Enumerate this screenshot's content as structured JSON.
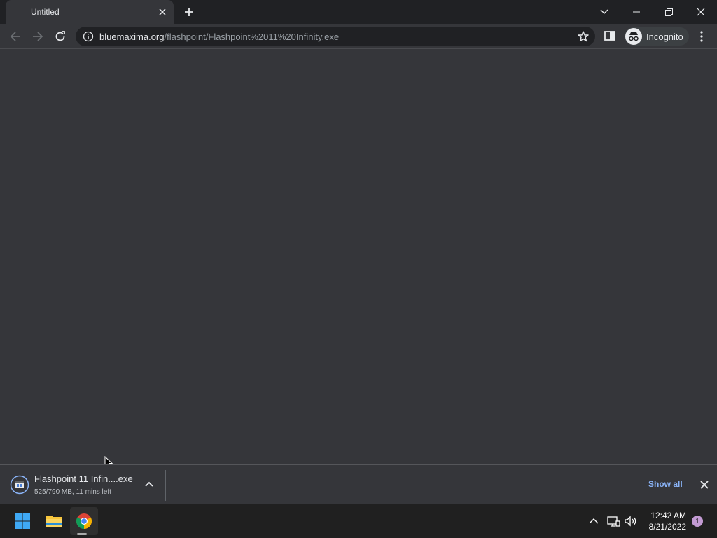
{
  "tab": {
    "title": "Untitled"
  },
  "omnibox": {
    "url_host": "bluemaxima.org",
    "url_path": "/flashpoint/Flashpoint%2011%20Infinity.exe"
  },
  "profile": {
    "label": "Incognito"
  },
  "download": {
    "file_name": "Flashpoint 11 Infin....exe",
    "status": "525/790 MB, 11 mins left",
    "show_all_label": "Show all"
  },
  "taskbar": {
    "time": "12:42 AM",
    "date": "8/21/2022",
    "notification_count": "1"
  },
  "colors": {
    "accent_link": "#8ab4f8",
    "chrome_dark": "#202124",
    "content_bg": "#35363a"
  },
  "icons": [
    "close-icon",
    "plus-icon",
    "chevron-down-icon",
    "minimize-icon",
    "restore-icon",
    "back-arrow-icon",
    "forward-arrow-icon",
    "reload-icon",
    "info-icon",
    "star-icon",
    "side-panel-icon",
    "incognito-icon",
    "more-vert-icon",
    "download-file-icon",
    "chevron-up-icon",
    "windows-start-icon",
    "file-explorer-icon",
    "chrome-icon",
    "tray-chevron-icon",
    "network-icon",
    "volume-icon",
    "mouse-cursor-icon"
  ]
}
